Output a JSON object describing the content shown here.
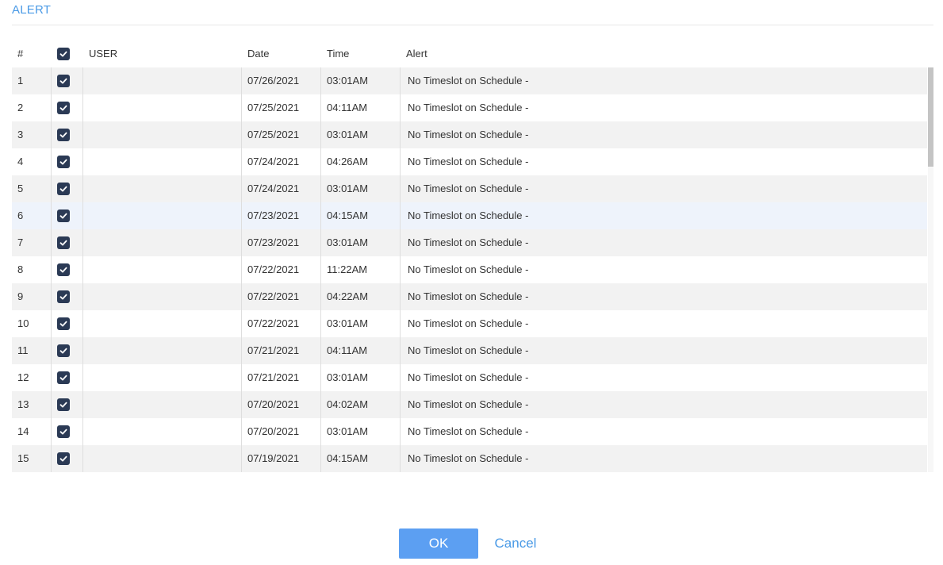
{
  "dialog": {
    "title": "ALERT",
    "ok_label": "OK",
    "cancel_label": "Cancel"
  },
  "table": {
    "columns": {
      "num": "#",
      "user": "USER",
      "date": "Date",
      "time": "Time",
      "alert": "Alert"
    },
    "select_all_checked": true,
    "highlighted_row": 6,
    "rows": [
      {
        "num": "1",
        "checked": true,
        "user": "",
        "date": "07/26/2021",
        "time": "03:01AM",
        "alert": "No Timeslot on Schedule -"
      },
      {
        "num": "2",
        "checked": true,
        "user": "",
        "date": "07/25/2021",
        "time": "04:11AM",
        "alert": "No Timeslot on Schedule -"
      },
      {
        "num": "3",
        "checked": true,
        "user": "",
        "date": "07/25/2021",
        "time": "03:01AM",
        "alert": "No Timeslot on Schedule -"
      },
      {
        "num": "4",
        "checked": true,
        "user": "",
        "date": "07/24/2021",
        "time": "04:26AM",
        "alert": "No Timeslot on Schedule -"
      },
      {
        "num": "5",
        "checked": true,
        "user": "",
        "date": "07/24/2021",
        "time": "03:01AM",
        "alert": "No Timeslot on Schedule -"
      },
      {
        "num": "6",
        "checked": true,
        "user": "",
        "date": "07/23/2021",
        "time": "04:15AM",
        "alert": "No Timeslot on Schedule -"
      },
      {
        "num": "7",
        "checked": true,
        "user": "",
        "date": "07/23/2021",
        "time": "03:01AM",
        "alert": "No Timeslot on Schedule -"
      },
      {
        "num": "8",
        "checked": true,
        "user": "",
        "date": "07/22/2021",
        "time": "11:22AM",
        "alert": "No Timeslot on Schedule -"
      },
      {
        "num": "9",
        "checked": true,
        "user": "",
        "date": "07/22/2021",
        "time": "04:22AM",
        "alert": "No Timeslot on Schedule -"
      },
      {
        "num": "10",
        "checked": true,
        "user": "",
        "date": "07/22/2021",
        "time": "03:01AM",
        "alert": "No Timeslot on Schedule -"
      },
      {
        "num": "11",
        "checked": true,
        "user": "",
        "date": "07/21/2021",
        "time": "04:11AM",
        "alert": "No Timeslot on Schedule -"
      },
      {
        "num": "12",
        "checked": true,
        "user": "",
        "date": "07/21/2021",
        "time": "03:01AM",
        "alert": "No Timeslot on Schedule -"
      },
      {
        "num": "13",
        "checked": true,
        "user": "",
        "date": "07/20/2021",
        "time": "04:02AM",
        "alert": "No Timeslot on Schedule -"
      },
      {
        "num": "14",
        "checked": true,
        "user": "",
        "date": "07/20/2021",
        "time": "03:01AM",
        "alert": "No Timeslot on Schedule -"
      },
      {
        "num": "15",
        "checked": true,
        "user": "",
        "date": "07/19/2021",
        "time": "04:15AM",
        "alert": "No Timeslot on Schedule -"
      }
    ]
  },
  "colors": {
    "accent": "#4a9ae6",
    "button": "#5c9ff2",
    "checkbox": "#2b3a55",
    "row_alt": "#f2f2f2",
    "row_highlight": "#eef3fb"
  },
  "icons": {
    "checkbox": "checkmark-icon"
  }
}
